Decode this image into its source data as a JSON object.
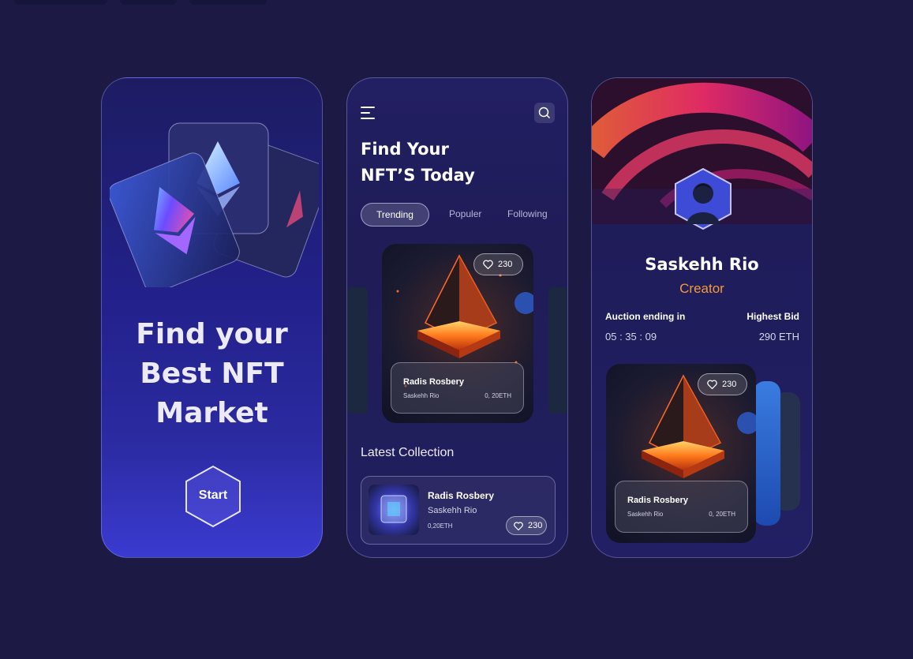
{
  "colors": {
    "background": "#1c1a44",
    "accent_orange": "#f39a3a",
    "text_primary": "#ffffff",
    "text_secondary": "#d6d5ea"
  },
  "screen_onboarding": {
    "title": "Find your Best NFT Market",
    "start_label": "Start"
  },
  "screen_home": {
    "title_line1": "Find Your",
    "title_line2": "NFT’S Today",
    "tabs": [
      {
        "label": "Trending"
      },
      {
        "label": "Populer"
      },
      {
        "label": "Following"
      }
    ],
    "featured": {
      "likes": "230",
      "name": "Radis Rosbery",
      "creator": "Saskehh Rio",
      "price": "0, 20ETH"
    },
    "latest_title": "Latest Collection",
    "latest_item": {
      "name": "Radis Rosbery",
      "creator": "Saskehh Rio",
      "price": "0,20ETH",
      "likes": "230"
    }
  },
  "screen_profile": {
    "name": "Saskehh Rio",
    "role": "Creator",
    "auction_label": "Auction ending in",
    "auction_time": "05 : 35 : 09",
    "bid_label": "Highest Bid",
    "bid_value": "290 ETH",
    "card": {
      "likes": "230",
      "name": "Radis Rosbery",
      "creator": "Saskehh Rio",
      "price": "0, 20ETH"
    }
  }
}
